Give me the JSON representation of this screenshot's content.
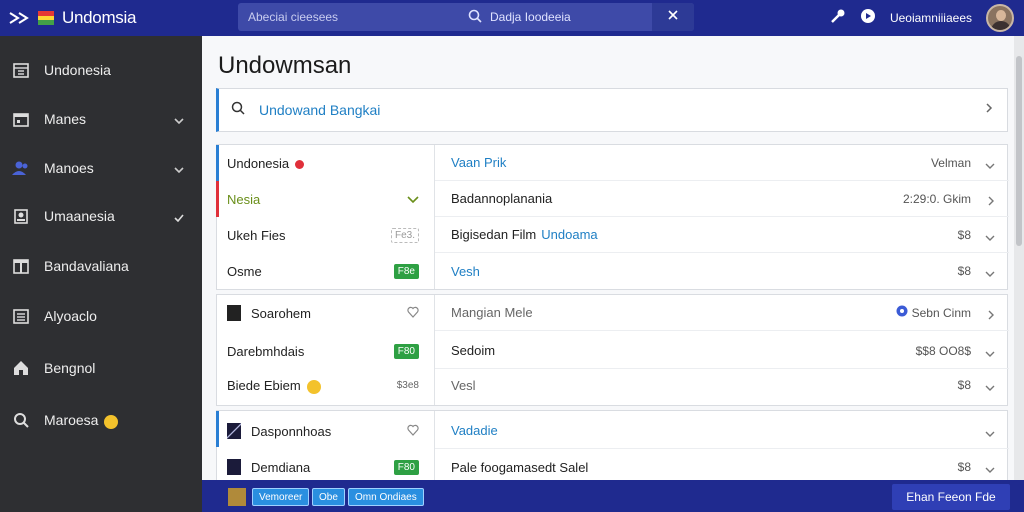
{
  "topbar": {
    "brand_title": "Undomsia",
    "search_left_text": "Abeciai cieesees",
    "search_right_text": "Dadja Ioodeeia",
    "user_name": "Ueoiamniiiaees"
  },
  "sidebar": {
    "items": [
      {
        "label": "Undonesia"
      },
      {
        "label": "Manes"
      },
      {
        "label": "Manoes"
      },
      {
        "label": "Umaanesia"
      },
      {
        "label": "Bandavaliana"
      },
      {
        "label": "Alyoaclo"
      },
      {
        "label": "Bengnol"
      },
      {
        "label": "Maroesa"
      }
    ]
  },
  "main": {
    "title": "Undowmsan",
    "search_text": "Undowand Bangkai"
  },
  "panel1": {
    "left": [
      {
        "label": "Undonesia"
      },
      {
        "label": "Nesia"
      },
      {
        "label": "Ukeh Fies",
        "badge": "Fe3."
      },
      {
        "label": "Osme",
        "badge": "F8e"
      }
    ],
    "right": [
      {
        "label": "Vaan Prik",
        "value": "Velman"
      },
      {
        "label": "Badannoplanania",
        "value": "2:29:0. Gkim"
      },
      {
        "label": "Bigisedan Film",
        "label_blue": "Undoama",
        "value": "$8"
      },
      {
        "label": "Vesh",
        "value": "$8"
      }
    ]
  },
  "panel2": {
    "left": [
      {
        "label": "Soarohem"
      },
      {
        "label": "Darebmhdais",
        "badge": "F80"
      },
      {
        "label": "Biede Ebiem",
        "badge": "$3e8"
      }
    ],
    "right": [
      {
        "label": "Mangian Mele",
        "value": "Sebn Cinm"
      },
      {
        "label": "Sedoim",
        "value": "$$8 OO8$"
      },
      {
        "label": "Vesl",
        "value": "$8"
      }
    ]
  },
  "panel3": {
    "left": [
      {
        "label": "Dasponnhoas"
      },
      {
        "label": "Demdiana",
        "badge": "F80"
      }
    ],
    "right": [
      {
        "label": "Vadadie"
      },
      {
        "label": "Pale foogamasedt Salel",
        "value": "$8"
      }
    ]
  },
  "bottom": {
    "chip1": "Vemoreer",
    "chip2": "Obe",
    "chip3": "Omn Ondiaes",
    "button": "Ehan Feeon Fde"
  },
  "colors": {
    "topbar": "#1f2a8f",
    "sidebar": "#2e2f32",
    "accent_blue": "#2a7fd4",
    "accent_red": "#e0303a",
    "badge_green": "#2ea043"
  }
}
